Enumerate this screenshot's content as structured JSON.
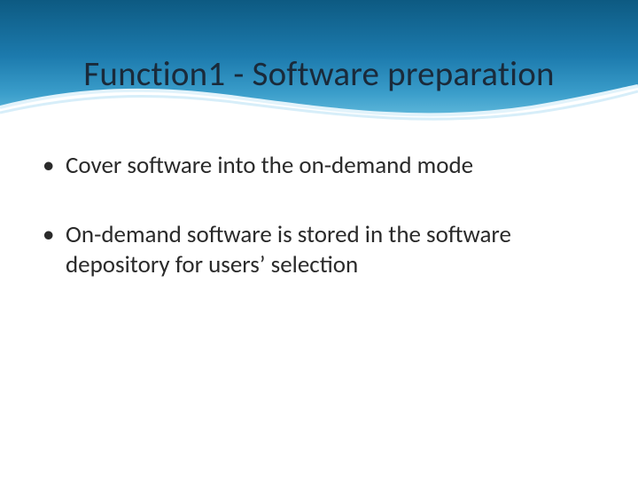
{
  "slide": {
    "title": "Function1 - Software preparation",
    "bullets": [
      "Cover software into the on-demand mode",
      "On-demand software is stored in the software depository for users’ selection"
    ]
  }
}
